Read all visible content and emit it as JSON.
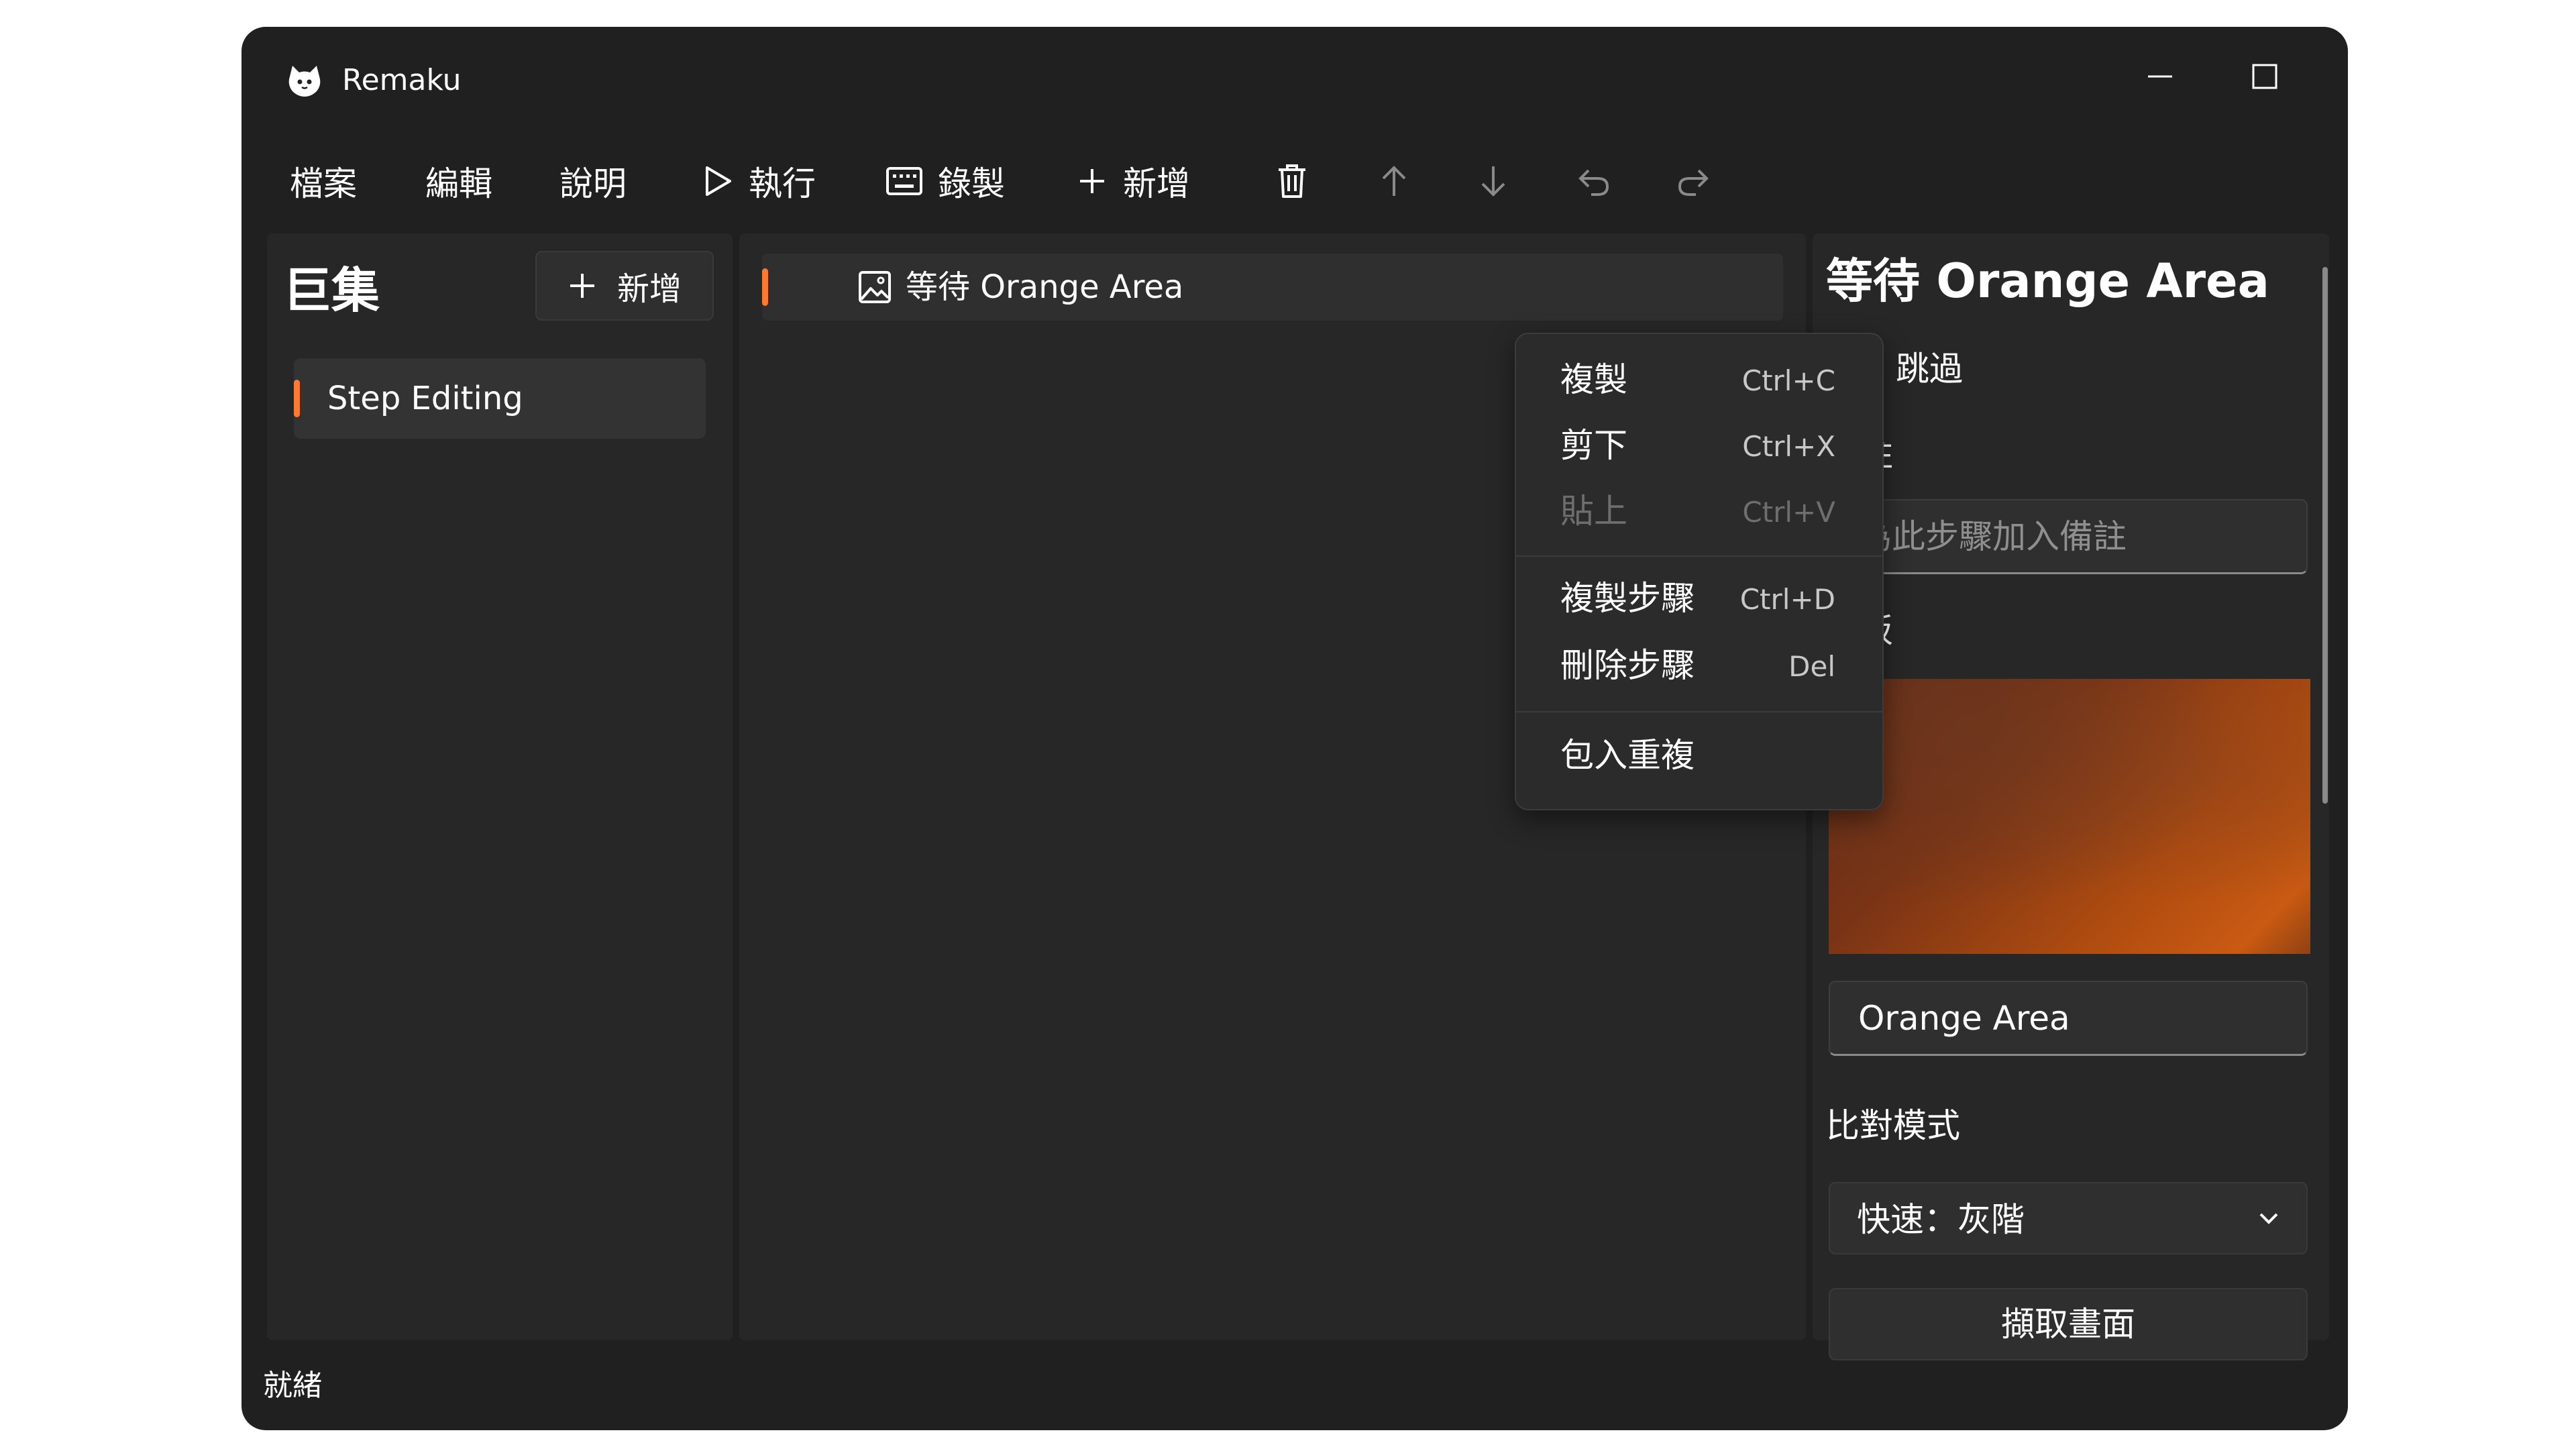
{
  "window": {
    "title": "Remaku",
    "controls": {
      "minimize": "minimize-icon",
      "maximize": "maximize-icon",
      "close": "close-icon"
    }
  },
  "toolbar": {
    "file_label": "檔案",
    "edit_label": "編輯",
    "help_label": "說明",
    "run_label": "執行",
    "record_label": "錄製",
    "add_label": "新增",
    "icons": [
      "play-icon",
      "keyboard-icon",
      "plus-icon",
      "trash-icon",
      "arrow-up-icon",
      "arrow-down-icon",
      "undo-icon",
      "redo-icon"
    ]
  },
  "macros": {
    "title": "巨集",
    "add_label": "新增",
    "items": [
      {
        "label": "Step Editing"
      }
    ]
  },
  "steps": [
    {
      "label": "等待 Orange Area",
      "icon": "image-icon"
    }
  ],
  "context_menu": {
    "items": [
      {
        "label": "複製",
        "shortcut": "Ctrl+C",
        "enabled": true
      },
      {
        "label": "剪下",
        "shortcut": "Ctrl+X",
        "enabled": true
      },
      {
        "label": "貼上",
        "shortcut": "Ctrl+V",
        "enabled": false
      },
      {
        "label": "複製步驟",
        "shortcut": "Ctrl+D",
        "enabled": true
      },
      {
        "label": "刪除步驟",
        "shortcut": "Del",
        "enabled": true
      },
      {
        "label": "包入重複",
        "shortcut": "",
        "enabled": true
      }
    ]
  },
  "properties": {
    "title": "等待 Orange Area",
    "skip_label": "跳過",
    "skip_checked": false,
    "note_label": "備註",
    "note_placeholder": "為此步驟加入備註",
    "note_value": "",
    "template_label": "模板",
    "template_name": "Orange Area",
    "compare_mode_label": "比對模式",
    "compare_mode_value": "快速：灰階",
    "capture_label": "擷取畫面"
  },
  "status": {
    "text": "就緒"
  },
  "colors": {
    "accent": "#ff7a2e",
    "background": "#202020",
    "panel": "#272727"
  }
}
